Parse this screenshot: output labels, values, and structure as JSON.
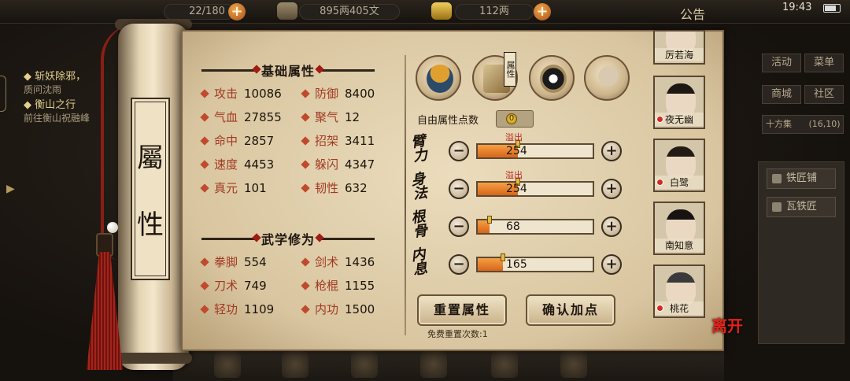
{
  "topbar": {
    "stamina_text": "22/180",
    "coins": "895两405文",
    "silver": "112两",
    "announcement": "公告",
    "time": "19:43"
  },
  "quests": [
    {
      "title": "斩妖除邪，",
      "desc": "质问沈雨"
    },
    {
      "title": "衡山之行",
      "desc": "前往衡山祝融峰"
    }
  ],
  "right_menu": {
    "buttons": [
      "活动",
      "菜单",
      "商城",
      "社区"
    ],
    "location": "十方集",
    "coords": "(16,10)",
    "shops": [
      "铁匠铺",
      "瓦铁匠"
    ]
  },
  "scroll_title": [
    "屬",
    "性"
  ],
  "basic_section": {
    "header": "基础属性",
    "stats": [
      {
        "name": "攻击",
        "value": "10086"
      },
      {
        "name": "防御",
        "value": "8400"
      },
      {
        "name": "气血",
        "value": "27855"
      },
      {
        "name": "聚气",
        "value": "12"
      },
      {
        "name": "命中",
        "value": "2857"
      },
      {
        "name": "招架",
        "value": "3411"
      },
      {
        "name": "速度",
        "value": "4453"
      },
      {
        "name": "躲闪",
        "value": "4347"
      },
      {
        "name": "真元",
        "value": "101"
      },
      {
        "name": "韧性",
        "value": "632"
      }
    ]
  },
  "martial_section": {
    "header": "武学修为",
    "stats": [
      {
        "name": "拳脚",
        "value": "554"
      },
      {
        "name": "剑术",
        "value": "1436"
      },
      {
        "name": "刀术",
        "value": "749"
      },
      {
        "name": "枪棍",
        "value": "1155"
      },
      {
        "name": "轻功",
        "value": "1109"
      },
      {
        "name": "内功",
        "value": "1500"
      }
    ]
  },
  "tabs": {
    "active_flag": "属性",
    "items": [
      "hero-icon",
      "scroll-icon",
      "bagua-icon",
      "meridian-icon"
    ]
  },
  "free_points": {
    "label": "自由属性点数",
    "value": "0"
  },
  "attributes": [
    {
      "label": "臂力",
      "value": "254",
      "fill": 0.35,
      "overflow": "溢出"
    },
    {
      "label": "身法",
      "value": "254",
      "fill": 0.35,
      "overflow": "溢出"
    },
    {
      "label": "根骨",
      "value": "68",
      "fill": 0.1,
      "overflow": ""
    },
    {
      "label": "内息",
      "value": "165",
      "fill": 0.22,
      "overflow": ""
    }
  ],
  "actions": {
    "reset": "重置属性",
    "confirm": "确认加点",
    "free_reset": "免费重置次数:1"
  },
  "party": [
    {
      "name": "厉若海",
      "dot": false
    },
    {
      "name": "夜无幽",
      "dot": true
    },
    {
      "name": "白鹭",
      "dot": true
    },
    {
      "name": "南知意",
      "dot": false
    },
    {
      "name": "桃花",
      "dot": true
    }
  ],
  "leave_label": "离开",
  "colors": {
    "accent_red": "#a13a25",
    "bar_orange": "#e07a24",
    "paper": "#e4d4b1"
  }
}
